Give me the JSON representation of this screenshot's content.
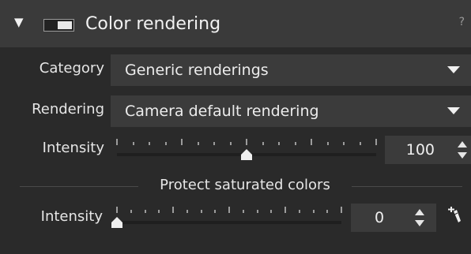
{
  "panel": {
    "title": "Color rendering",
    "help": "?",
    "collapse_icon": "triangle-down-icon",
    "toggle_icon": "switch-icon"
  },
  "category": {
    "label": "Category",
    "value": "Generic renderings"
  },
  "rendering": {
    "label": "Rendering",
    "value": "Camera default rendering"
  },
  "intensity": {
    "label": "Intensity",
    "value": "100",
    "level_fraction": 0.5
  },
  "protect": {
    "title": "Protect saturated colors",
    "intensity_label": "Intensity",
    "value": "0",
    "level_fraction": 0.0,
    "picker_icon": "eyedropper-icon"
  },
  "colors": {
    "panel_bg": "#2a2a2a",
    "header_bg": "#3a3a3a",
    "field_bg": "#3b3b3b",
    "text": "#e6e6e6"
  }
}
